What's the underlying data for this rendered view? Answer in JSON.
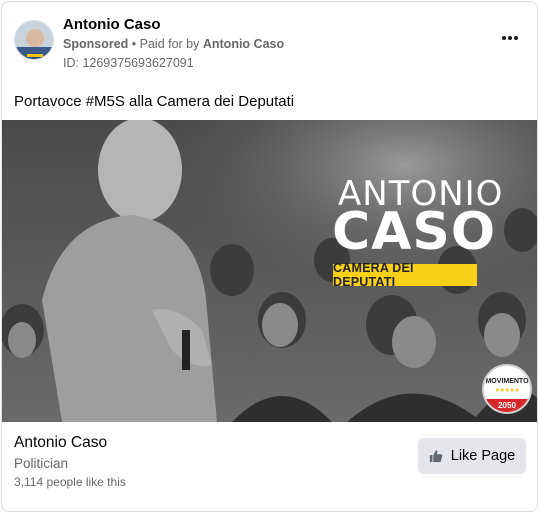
{
  "header": {
    "page_name": "Antonio Caso",
    "sponsored_label": "Sponsored",
    "separator": " • ",
    "paid_for_label": "Paid for by ",
    "payer_name": "Antonio Caso",
    "ad_id": "ID: 1269375693627091",
    "more_icon": "more-horizontal-icon"
  },
  "post": {
    "text": "Portavoce #M5S alla Camera dei Deputati"
  },
  "media": {
    "overlay_first_name": "ANTONIO",
    "overlay_last_name": "CASO",
    "overlay_tagline": "CAMERA DEI DEPUTATI",
    "logo_text": "MOVIMENTO",
    "logo_stars": "★★★★★",
    "logo_year": "2050",
    "accent_yellow": "#f7d117",
    "logo_red": "#d62828"
  },
  "footer": {
    "page_title": "Antonio Caso",
    "category": "Politician",
    "likes_text": "3,114 people like this",
    "like_button_label": "Like Page",
    "like_icon": "thumbs-up-icon"
  }
}
